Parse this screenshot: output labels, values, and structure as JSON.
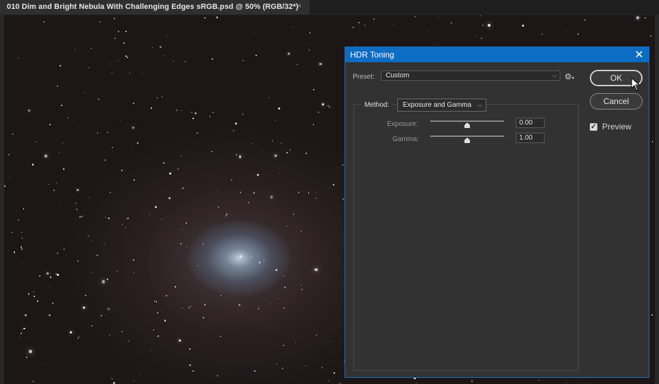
{
  "document_tab": {
    "title": "010 Dim and Bright Nebula With Challenging Edges sRGB.psd @ 50% (RGB/32*)",
    "close_glyph": "×"
  },
  "dialog": {
    "title": "HDR Toning",
    "close_glyph": "✕",
    "preset": {
      "label": "Preset:",
      "value": "Custom",
      "options_icon": "gear-icon"
    },
    "method": {
      "label": "Method:",
      "value": "Exposure and Gamma"
    },
    "sliders": [
      {
        "label": "Exposure:",
        "value": "0.00",
        "level": 0.5
      },
      {
        "label": "Gamma:",
        "value": "1.00",
        "level": 0.5
      }
    ],
    "buttons": {
      "ok": "OK",
      "cancel": "Cancel"
    },
    "preview": {
      "label": "Preview",
      "checked": true
    }
  },
  "colors": {
    "titlebar_accent": "#0d6cc4",
    "dialog_bg": "#323232",
    "canvas_bg": "#221a1a"
  }
}
